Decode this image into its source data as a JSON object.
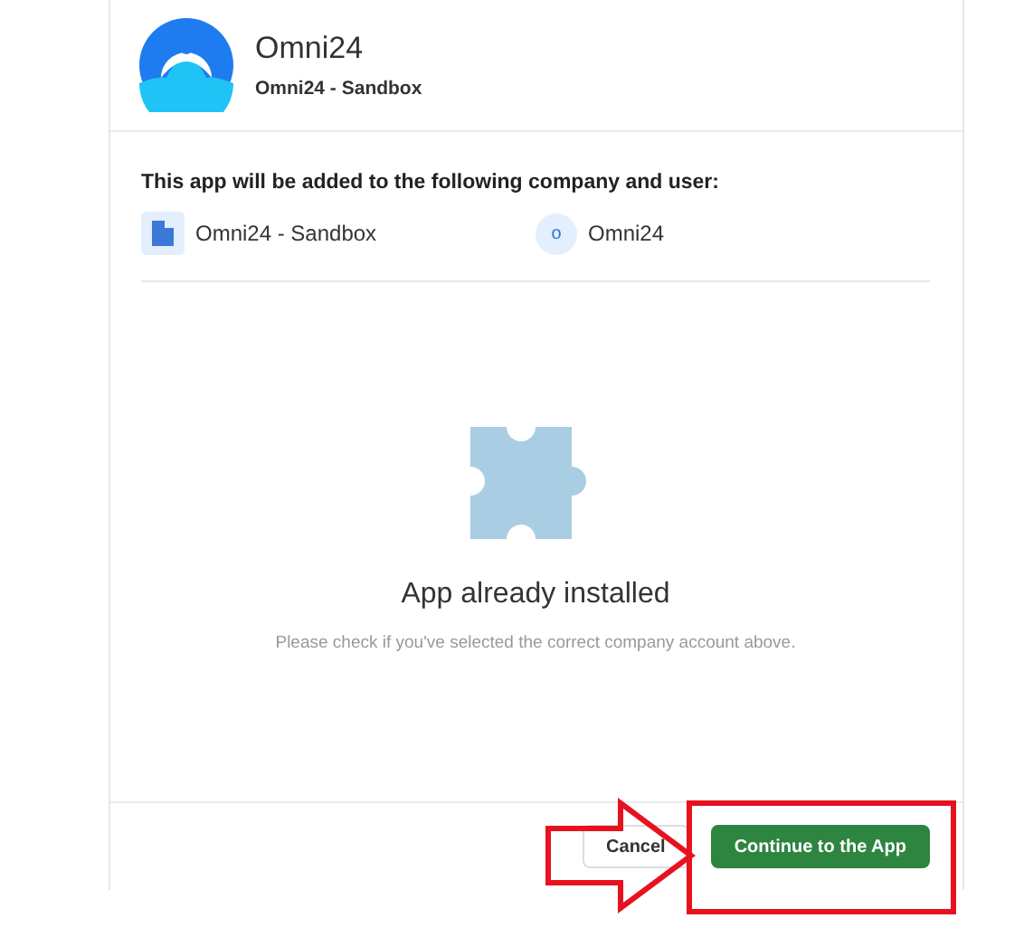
{
  "app": {
    "name": "Omni24",
    "account": "Omni24 - Sandbox"
  },
  "target": {
    "heading": "This app will be added to the following company and user:",
    "company": "Omni24 - Sandbox",
    "user_initial": "o",
    "user": "Omni24"
  },
  "status": {
    "title": "App already installed",
    "message": "Please check if you've selected the correct company account above."
  },
  "buttons": {
    "cancel": "Cancel",
    "continue": "Continue to the App"
  }
}
